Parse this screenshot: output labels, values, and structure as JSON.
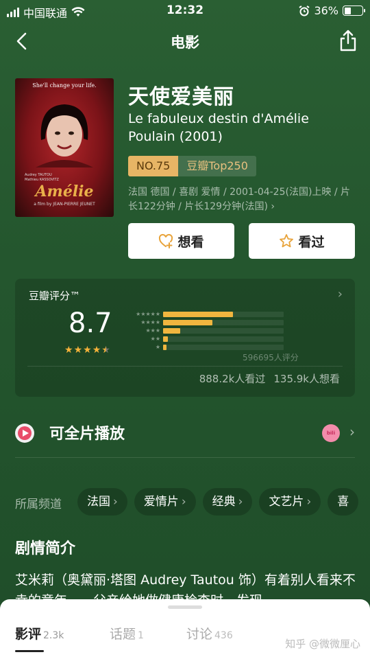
{
  "status_bar": {
    "carrier": "中国联通",
    "time": "12:32",
    "battery": "36%",
    "battery_level": 0.36
  },
  "nav": {
    "title": "电影"
  },
  "movie": {
    "title": "天使爱美丽",
    "original_title": "Le fabuleux destin d'Amélie Poulain (2001)",
    "rank_no": "NO.75",
    "rank_list": "豆瓣Top250",
    "meta": "法国 德国 / 喜剧 爱情 / 2001-04-25(法国)上映 / 片长122分钟 / 片长129分钟(法国) ›",
    "poster": {
      "tagline": "She'll change your life.",
      "cast": [
        "Audrey TAUTOU",
        "Mathieu KASSOVITZ"
      ],
      "logo": "Amélie",
      "credit": "a film by JEAN-PIERRE JEUNET"
    }
  },
  "actions": {
    "want": "想看",
    "seen": "看过"
  },
  "rating": {
    "label": "豆瓣评分™",
    "score": "8.7",
    "stars": 4.5,
    "distribution": [
      0.58,
      0.41,
      0.14,
      0.04,
      0.03
    ],
    "count": "596695人评分",
    "seen": "888.2k人看过",
    "want": "135.9k人想看"
  },
  "playable": {
    "text": "可全片播放",
    "provider_badge": "bilibili"
  },
  "channels": {
    "label": "所属频道",
    "items": [
      "法国",
      "爱情片",
      "经典",
      "文艺片",
      "喜"
    ]
  },
  "synopsis": {
    "title": "剧情简介",
    "text": "艾米莉（奥黛丽·塔图 Audrey Tautou 饰）有着别人看来不幸的童年——父亲给她做健康检查时，发现"
  },
  "tabs": [
    {
      "label": "影评",
      "count": "2.3k"
    },
    {
      "label": "话题",
      "count": "1"
    },
    {
      "label": "讨论",
      "count": "436"
    }
  ],
  "watermark": "知乎 @微微厘心"
}
